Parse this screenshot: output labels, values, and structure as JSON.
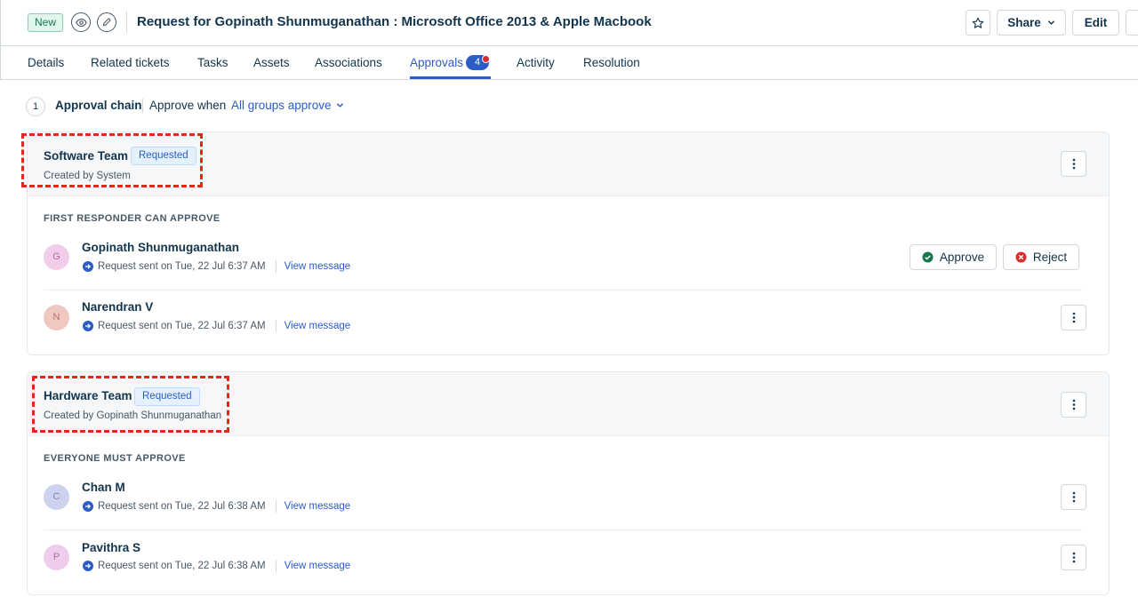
{
  "header": {
    "status": "New",
    "title": "Request for Gopinath Shunmuganathan : Microsoft Office 2013 & Apple Macbook",
    "share_label": "Share",
    "edit_label": "Edit"
  },
  "tabs": [
    {
      "label": "Details"
    },
    {
      "label": "Related tickets"
    },
    {
      "label": "Tasks"
    },
    {
      "label": "Assets"
    },
    {
      "label": "Associations"
    },
    {
      "label": "Approvals",
      "count": "4",
      "active": true
    },
    {
      "label": "Activity"
    },
    {
      "label": "Resolution"
    }
  ],
  "chain": {
    "number": "1",
    "label": "Approval chain",
    "approve_when": "Approve when",
    "selected": "All groups approve"
  },
  "groups": [
    {
      "name": "Software Team",
      "status": "Requested",
      "created_by": "Created by System",
      "rule": "FIRST RESPONDER CAN APPROVE",
      "approvers": [
        {
          "initial": "G",
          "name": "Gopinath Shunmuganathan",
          "sent": "Request sent on Tue, 22 Jul 6:37 AM",
          "link": "View message",
          "approve_label": "Approve",
          "reject_label": "Reject"
        },
        {
          "initial": "N",
          "name": "Narendran V",
          "sent": "Request sent on Tue, 22 Jul 6:37 AM",
          "link": "View message"
        }
      ]
    },
    {
      "name": "Hardware Team",
      "status": "Requested",
      "created_by": "Created by Gopinath Shunmuganathan",
      "rule": "EVERYONE MUST APPROVE",
      "approvers": [
        {
          "initial": "C",
          "name": "Chan M",
          "sent": "Request sent on Tue, 22 Jul 6:38 AM",
          "link": "View message"
        },
        {
          "initial": "P",
          "name": "Pavithra S",
          "sent": "Request sent on Tue, 22 Jul 6:38 AM",
          "link": "View message"
        }
      ]
    }
  ],
  "colors": {
    "accent": "#2c5cc5",
    "success": "#18784d",
    "danger": "#d72d30",
    "highlight": "#e5261a"
  }
}
